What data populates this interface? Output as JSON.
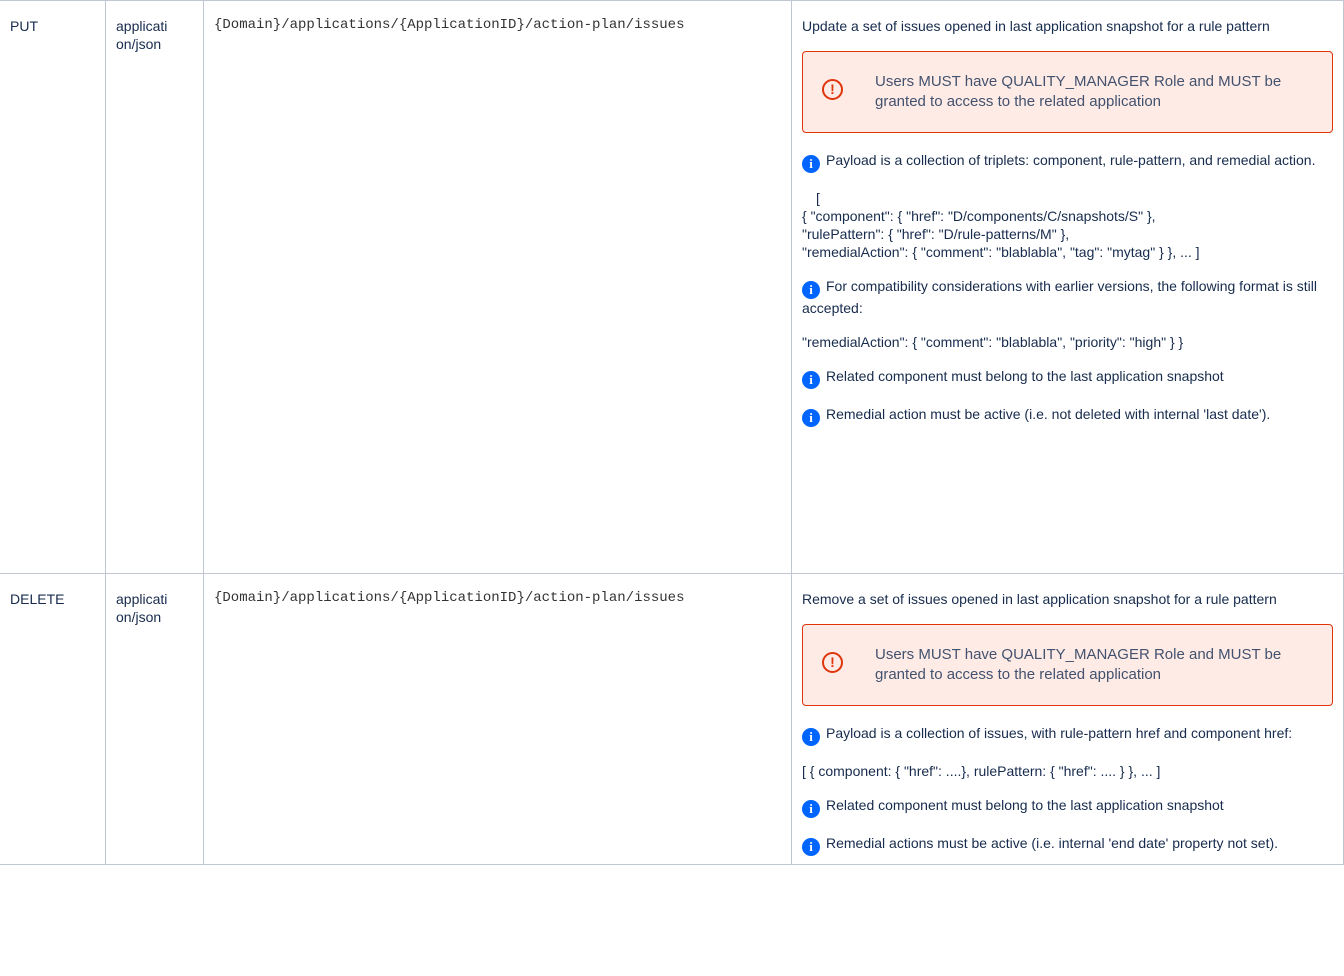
{
  "rows": [
    {
      "method": "PUT",
      "content_type": "application/json",
      "url": "{Domain}/applications/{ApplicationID}/action-plan/issues",
      "summary": "Update a set of issues opened in last application snapshot for a rule pattern",
      "warning": "Users MUST have QUALITY_MANAGER Role and MUST be granted to access to the related application",
      "info_payload": "Payload is a collection of triplets: component, rule-pattern, and remedial action.",
      "payload_example": {
        "open": "[",
        "line1": "{ \"component\": { \"href\": \"D/components/C/snapshots/S\" },",
        "line2": "\"rulePattern\": { \"href\": \"D/rule-patterns/M\" },",
        "line3": "\"remedialAction\": { \"comment\": \"blablabla\", \"tag\": \"mytag\" } }, ... ]"
      },
      "info_compat": "For compatibility considerations with earlier versions, the following format is still accepted:",
      "compat_example": "\"remedialAction\": { \"comment\": \"blablabla\", \"priority\": \"high\" } }",
      "info_component": "Related component must belong to the last application snapshot",
      "info_active": "Remedial action must be active (i.e. not deleted with internal 'last date')."
    },
    {
      "method": "DELETE",
      "content_type": "application/json",
      "url": "{Domain}/applications/{ApplicationID}/action-plan/issues",
      "summary": "Remove a set of issues opened in last application snapshot for a rule pattern",
      "warning": "Users MUST have QUALITY_MANAGER Role and MUST be granted to access to the related application",
      "info_payload": "Payload is a collection of issues, with rule-pattern href and component href:",
      "payload_example": "[ { component: { \"href\": ....}, rulePattern: { \"href\": .... } }, ... ]",
      "info_component": "Related component must belong to the last application snapshot",
      "info_active": "Remedial actions must be active (i.e. internal 'end date' property not set)."
    }
  ],
  "icons": {
    "warning": "exclamation-circle-icon",
    "info": "info-circle-icon",
    "warning_color": "#de350b",
    "info_color": "#0065ff"
  }
}
